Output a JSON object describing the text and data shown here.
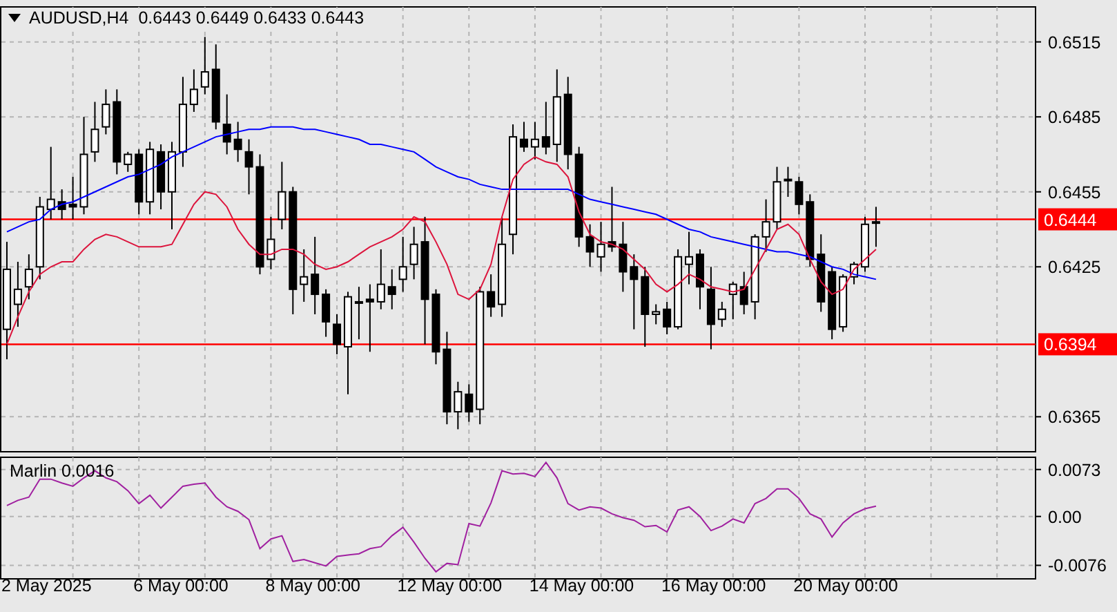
{
  "chart_header": {
    "symbol": "AUDUSD,H4",
    "values": [
      "0.6443",
      "0.6449",
      "0.6433",
      "0.6443"
    ]
  },
  "price_chart": {
    "chart_data": {
      "type": "candlestick",
      "grid": true,
      "ylim": [
        0.6351,
        0.6529
      ],
      "yticks": [
        0.6365,
        0.6425,
        0.6455,
        0.6485,
        0.6515
      ],
      "ohlc": [
        [
          0.64,
          0.6435,
          0.6388,
          0.6424
        ],
        [
          0.641,
          0.6427,
          0.6401,
          0.6416
        ],
        [
          0.6417,
          0.643,
          0.6412,
          0.6424
        ],
        [
          0.6425,
          0.6453,
          0.642,
          0.6449
        ],
        [
          0.6448,
          0.6473,
          0.6444,
          0.6452
        ],
        [
          0.6451,
          0.6456,
          0.6444,
          0.6448
        ],
        [
          0.645,
          0.6461,
          0.6444,
          0.6449
        ],
        [
          0.6449,
          0.6485,
          0.6446,
          0.647
        ],
        [
          0.6471,
          0.6491,
          0.6467,
          0.648
        ],
        [
          0.6481,
          0.6496,
          0.6478,
          0.649
        ],
        [
          0.6491,
          0.6496,
          0.6462,
          0.6467
        ],
        [
          0.6466,
          0.6471,
          0.6463,
          0.647
        ],
        [
          0.647,
          0.6472,
          0.6446,
          0.6451
        ],
        [
          0.6451,
          0.6475,
          0.6446,
          0.6472
        ],
        [
          0.6471,
          0.6474,
          0.6448,
          0.6455
        ],
        [
          0.6455,
          0.6475,
          0.644,
          0.6471
        ],
        [
          0.6471,
          0.6501,
          0.6465,
          0.649
        ],
        [
          0.649,
          0.6504,
          0.6487,
          0.6496
        ],
        [
          0.6497,
          0.6517,
          0.6494,
          0.6503
        ],
        [
          0.6504,
          0.6514,
          0.648,
          0.6483
        ],
        [
          0.6482,
          0.6494,
          0.647,
          0.6475
        ],
        [
          0.6476,
          0.6483,
          0.6467,
          0.6472
        ],
        [
          0.6471,
          0.6476,
          0.6454,
          0.6465
        ],
        [
          0.6465,
          0.647,
          0.6422,
          0.6425
        ],
        [
          0.6428,
          0.6445,
          0.6424,
          0.6436
        ],
        [
          0.6444,
          0.6467,
          0.644,
          0.6455
        ],
        [
          0.6455,
          0.6457,
          0.6406,
          0.6416
        ],
        [
          0.6418,
          0.6432,
          0.6411,
          0.6421
        ],
        [
          0.6422,
          0.6437,
          0.6406,
          0.6414
        ],
        [
          0.6414,
          0.6416,
          0.6397,
          0.6403
        ],
        [
          0.6402,
          0.6406,
          0.639,
          0.6394
        ],
        [
          0.6393,
          0.6415,
          0.6374,
          0.6413
        ],
        [
          0.6411,
          0.6417,
          0.6396,
          0.6411
        ],
        [
          0.6412,
          0.6418,
          0.6391,
          0.6411
        ],
        [
          0.6411,
          0.6432,
          0.6408,
          0.6418
        ],
        [
          0.6417,
          0.6424,
          0.6408,
          0.6414
        ],
        [
          0.642,
          0.6437,
          0.6415,
          0.6425
        ],
        [
          0.6426,
          0.6441,
          0.642,
          0.6434
        ],
        [
          0.6435,
          0.6445,
          0.6394,
          0.6412
        ],
        [
          0.6414,
          0.6416,
          0.6386,
          0.6391
        ],
        [
          0.6392,
          0.6399,
          0.6362,
          0.6367
        ],
        [
          0.6367,
          0.6379,
          0.636,
          0.6375
        ],
        [
          0.6374,
          0.6378,
          0.6363,
          0.6367
        ],
        [
          0.6368,
          0.6417,
          0.6362,
          0.6415
        ],
        [
          0.6415,
          0.6422,
          0.6405,
          0.6409
        ],
        [
          0.641,
          0.6445,
          0.6405,
          0.6434
        ],
        [
          0.6438,
          0.6482,
          0.643,
          0.6477
        ],
        [
          0.6476,
          0.6483,
          0.6471,
          0.6473
        ],
        [
          0.6473,
          0.6483,
          0.6468,
          0.6476
        ],
        [
          0.6477,
          0.6491,
          0.647,
          0.6473
        ],
        [
          0.6474,
          0.6504,
          0.6467,
          0.6493
        ],
        [
          0.6494,
          0.6501,
          0.6464,
          0.647
        ],
        [
          0.647,
          0.6473,
          0.6433,
          0.6437
        ],
        [
          0.6437,
          0.6442,
          0.6425,
          0.6431
        ],
        [
          0.6429,
          0.6443,
          0.6423,
          0.6434
        ],
        [
          0.6435,
          0.6457,
          0.6431,
          0.6433
        ],
        [
          0.6434,
          0.6443,
          0.6415,
          0.6423
        ],
        [
          0.6425,
          0.643,
          0.64,
          0.642
        ],
        [
          0.6421,
          0.6425,
          0.6393,
          0.6406
        ],
        [
          0.6406,
          0.641,
          0.6402,
          0.6407
        ],
        [
          0.6408,
          0.6411,
          0.6398,
          0.6401
        ],
        [
          0.6401,
          0.6432,
          0.64,
          0.6429
        ],
        [
          0.6426,
          0.6439,
          0.6418,
          0.6429
        ],
        [
          0.643,
          0.6432,
          0.6408,
          0.6417
        ],
        [
          0.6416,
          0.6425,
          0.6392,
          0.6402
        ],
        [
          0.6404,
          0.6411,
          0.6401,
          0.6408
        ],
        [
          0.6414,
          0.6419,
          0.6404,
          0.6418
        ],
        [
          0.6417,
          0.6423,
          0.6406,
          0.641
        ],
        [
          0.6411,
          0.6438,
          0.6404,
          0.6437
        ],
        [
          0.6437,
          0.6452,
          0.6431,
          0.6443
        ],
        [
          0.6443,
          0.6465,
          0.644,
          0.6459
        ],
        [
          0.646,
          0.6465,
          0.6453,
          0.646
        ],
        [
          0.6459,
          0.6461,
          0.6446,
          0.645
        ],
        [
          0.6451,
          0.6454,
          0.6425,
          0.6428
        ],
        [
          0.643,
          0.6438,
          0.6407,
          0.6411
        ],
        [
          0.6423,
          0.6425,
          0.6396,
          0.64
        ],
        [
          0.6401,
          0.6422,
          0.6399,
          0.6421
        ],
        [
          0.6421,
          0.6427,
          0.6418,
          0.6426
        ],
        [
          0.6425,
          0.6445,
          0.6423,
          0.6442
        ],
        [
          0.6443,
          0.6449,
          0.6433,
          0.6443
        ],
        null,
        null,
        null,
        null,
        null,
        null,
        null,
        null,
        null,
        null,
        null,
        null,
        null,
        null
      ],
      "series": [
        {
          "type": "line",
          "color": "#0000ff",
          "values": [
            0.6439,
            0.6441,
            0.6443,
            0.6444,
            0.6448,
            0.645,
            0.6451,
            0.6453,
            0.6455,
            0.6457,
            0.6459,
            0.6461,
            0.6462,
            0.6464,
            0.6466,
            0.6469,
            0.6471,
            0.6473,
            0.6475,
            0.6477,
            0.6478,
            0.6479,
            0.648,
            0.648,
            0.6481,
            0.6481,
            0.6481,
            0.648,
            0.648,
            0.6479,
            0.6478,
            0.6477,
            0.6476,
            0.6474,
            0.6474,
            0.6473,
            0.6472,
            0.6471,
            0.6468,
            0.6465,
            0.6463,
            0.6461,
            0.646,
            0.6458,
            0.6457,
            0.6456,
            0.6456,
            0.6456,
            0.6456,
            0.6456,
            0.6456,
            0.6456,
            0.6454,
            0.6452,
            0.6451,
            0.645,
            0.6449,
            0.6448,
            0.6447,
            0.6446,
            0.6444,
            0.6442,
            0.644,
            0.6439,
            0.6437,
            0.6436,
            0.6435,
            0.6434,
            0.6433,
            0.6432,
            0.6431,
            0.6431,
            0.643,
            0.6429,
            0.6427,
            0.6425,
            0.6424,
            0.6422,
            0.6421,
            0.642,
            null,
            null,
            null,
            null,
            null,
            null,
            null,
            null,
            null,
            null,
            null,
            null,
            null,
            null
          ]
        },
        {
          "type": "line",
          "color": "#dc143c",
          "values": [
            0.6394,
            0.6405,
            0.6415,
            0.6422,
            0.6425,
            0.6427,
            0.6427,
            0.6432,
            0.6436,
            0.6438,
            0.6437,
            0.6435,
            0.6433,
            0.6433,
            0.6433,
            0.6434,
            0.6442,
            0.645,
            0.6455,
            0.6454,
            0.6449,
            0.644,
            0.6434,
            0.643,
            0.643,
            0.6432,
            0.6432,
            0.643,
            0.6426,
            0.6424,
            0.6425,
            0.6427,
            0.643,
            0.6433,
            0.6435,
            0.6437,
            0.644,
            0.6445,
            0.6443,
            0.6435,
            0.6426,
            0.6414,
            0.6412,
            0.6416,
            0.6426,
            0.6445,
            0.646,
            0.6466,
            0.6469,
            0.6467,
            0.6466,
            0.6461,
            0.6447,
            0.6438,
            0.6435,
            0.6434,
            0.6432,
            0.6428,
            0.6424,
            0.6418,
            0.6415,
            0.6418,
            0.6422,
            0.642,
            0.6417,
            0.6416,
            0.6415,
            0.6416,
            0.6424,
            0.6432,
            0.644,
            0.6442,
            0.6438,
            0.6428,
            0.6419,
            0.6414,
            0.6416,
            0.6424,
            0.6428,
            0.6432,
            null,
            null,
            null,
            null,
            null,
            null,
            null,
            null,
            null,
            null,
            null,
            null,
            null,
            null
          ]
        }
      ],
      "ref_lines": [
        {
          "axis": "y",
          "value": 0.6444,
          "label": "0.6444",
          "color": "#ff0000"
        },
        {
          "axis": "y",
          "value": 0.6394,
          "label": "0.6394",
          "color": "#ff0000"
        }
      ]
    }
  },
  "indicator_chart": {
    "chart_data": {
      "type": "line",
      "grid": true,
      "title": "Marlin 0.0016",
      "ylim": [
        -0.0097,
        0.0092
      ],
      "yticks": [
        {
          "value": 0.0073,
          "label": "0.0073"
        },
        {
          "value": 0,
          "label": "0.00"
        },
        {
          "value": -0.0076,
          "label": "-0.0076"
        }
      ],
      "series": [
        {
          "color": "#a020a0",
          "values": [
            0.0017,
            0.0025,
            0.003,
            0.0058,
            0.0058,
            0.0052,
            0.0047,
            0.006,
            0.0071,
            0.006,
            0.0054,
            0.004,
            0.002,
            0.0033,
            0.0013,
            0.003,
            0.0047,
            0.005,
            0.0052,
            0.003,
            0.0015,
            0.0008,
            -0.0005,
            -0.005,
            -0.0035,
            -0.003,
            -0.007,
            -0.0067,
            -0.0072,
            -0.0077,
            -0.0062,
            -0.006,
            -0.0058,
            -0.005,
            -0.0047,
            -0.003,
            -0.0017,
            -0.004,
            -0.0065,
            -0.0086,
            -0.0073,
            -0.0075,
            -0.0011,
            -0.0015,
            0.0021,
            0.0071,
            0.0066,
            0.0067,
            0.0062,
            0.0084,
            0.006,
            0.002,
            0.001,
            0.0015,
            0.0013,
            0.0004,
            -0.0002,
            -0.0006,
            -0.0016,
            -0.0014,
            -0.0024,
            0.001,
            0.0015,
            0.0,
            -0.0022,
            -0.0015,
            -0.0004,
            -0.001,
            0.002,
            0.0028,
            0.0043,
            0.0043,
            0.0028,
            0.0004,
            -0.0004,
            -0.0032,
            -0.001,
            0.0004,
            0.0012,
            0.0016,
            null,
            null,
            null,
            null,
            null,
            null,
            null,
            null,
            null,
            null,
            null,
            null,
            null,
            null
          ]
        }
      ]
    }
  },
  "time_axis": {
    "labels": [
      "2 May 2025",
      "6 May 00:00",
      "8 May 00:00",
      "12 May 00:00",
      "14 May 00:00",
      "16 May 00:00",
      "20 May 00:00"
    ]
  }
}
